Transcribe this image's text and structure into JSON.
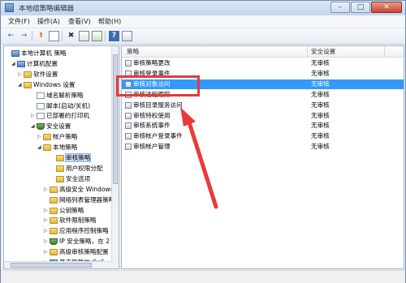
{
  "window": {
    "title": "本地组策略编辑器"
  },
  "titlebar_buttons": {
    "minimize": "–",
    "maximize": "□",
    "close": "✕"
  },
  "menu": [
    "文件(F)",
    "操作(A)",
    "查看(V)",
    "帮助(H)"
  ],
  "toolbar": {
    "back": "←",
    "forward": "→",
    "up": "⬆",
    "close": "✖",
    "help": "?"
  },
  "tree": [
    {
      "label": "本地计算机 策略",
      "expander": "",
      "icon": "computer"
    },
    {
      "label": "计算机配置",
      "expander": "◢",
      "icon": "computer"
    },
    {
      "label": "软件设置",
      "expander": "▷",
      "icon": "folder"
    },
    {
      "label": "Windows 设置",
      "expander": "◢",
      "icon": "folder"
    },
    {
      "label": "域名解析策略",
      "expander": "",
      "icon": "doc"
    },
    {
      "label": "脚本(启动/关机)",
      "expander": "",
      "icon": "doc"
    },
    {
      "label": "已部署的打印机",
      "expander": "▷",
      "icon": "doc"
    },
    {
      "label": "安全设置",
      "expander": "◢",
      "icon": "shield"
    },
    {
      "label": "帐户策略",
      "expander": "▷",
      "icon": "folder"
    },
    {
      "label": "本地策略",
      "expander": "◢",
      "icon": "folder"
    },
    {
      "label": "审核策略",
      "expander": "",
      "icon": "folder",
      "selected": true
    },
    {
      "label": "用户权限分配",
      "expander": "",
      "icon": "folder"
    },
    {
      "label": "安全选项",
      "expander": "",
      "icon": "folder"
    },
    {
      "label": "高级安全 Windows",
      "expander": "▷",
      "icon": "folder"
    },
    {
      "label": "网络列表管理器策略",
      "expander": "",
      "icon": "folder"
    },
    {
      "label": "公钥策略",
      "expander": "▷",
      "icon": "folder"
    },
    {
      "label": "软件限制策略",
      "expander": "▷",
      "icon": "folder"
    },
    {
      "label": "应用程序控制策略",
      "expander": "▷",
      "icon": "folder"
    },
    {
      "label": "IP 安全策略，在 2",
      "expander": "▷",
      "icon": "shield"
    },
    {
      "label": "高级审核策略配置",
      "expander": "▷",
      "icon": "folder"
    },
    {
      "label": "基于策略的 QoS",
      "expander": "▷",
      "icon": "bars"
    }
  ],
  "list": {
    "headers": {
      "policy": "策略",
      "setting": "安全设置"
    },
    "rows": [
      {
        "name": "审核策略更改",
        "value": "无审核"
      },
      {
        "name": "审核登录事件",
        "value": "无审核"
      },
      {
        "name": "审核对象访问",
        "value": "无审核",
        "selected": true
      },
      {
        "name": "审核进程跟踪",
        "value": "无审核"
      },
      {
        "name": "审核目录服务访问",
        "value": "无审核"
      },
      {
        "name": "审核特权使用",
        "value": "无审核"
      },
      {
        "name": "审核系统事件",
        "value": "无审核"
      },
      {
        "name": "审核帐户登录事件",
        "value": "无审核"
      },
      {
        "name": "审核帐户管理",
        "value": "无审核"
      }
    ]
  },
  "watermark": "Bai 经验",
  "colors": {
    "selection": "#3399ff",
    "annotation": "#e83a3a"
  }
}
